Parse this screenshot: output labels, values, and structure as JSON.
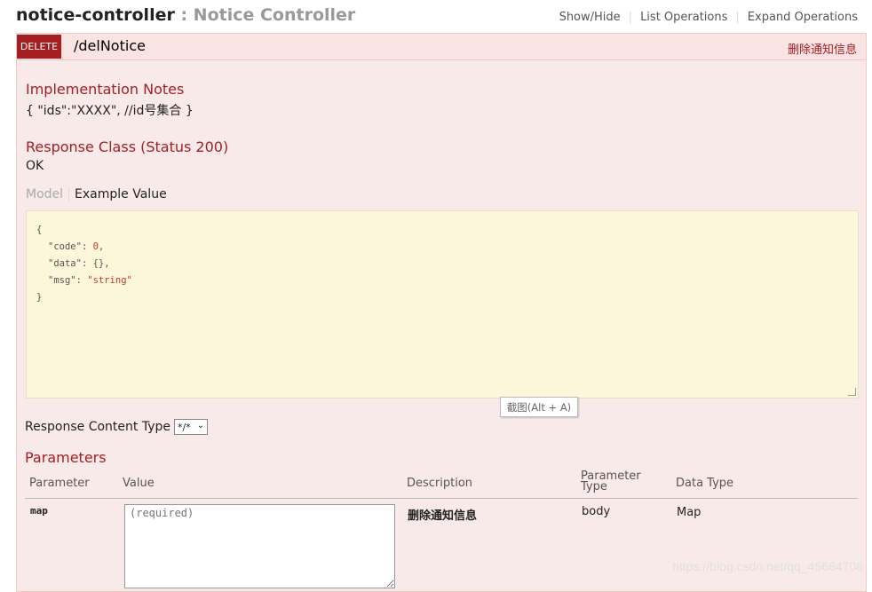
{
  "resource": {
    "name": "notice-controller",
    "separator": " : ",
    "description": "Notice Controller"
  },
  "header_links": {
    "show_hide": "Show/Hide",
    "list_operations": "List Operations",
    "expand_operations": "Expand Operations"
  },
  "operation": {
    "method": "DELETE",
    "path": "/delNotice",
    "summary": "删除通知信息",
    "implementation_notes_title": "Implementation Notes",
    "implementation_notes": "{ \"ids\":\"XXXX\", //id号集合 }",
    "response_class_title": "Response Class (Status 200)",
    "response_class_value": "OK",
    "tabs": {
      "model": "Model",
      "example": "Example Value"
    },
    "example": {
      "open": "{",
      "line1_key": "\"code\"",
      "line1_val": "0",
      "line2_key": "\"data\"",
      "line2_val": "{}",
      "line3_key": "\"msg\"",
      "line3_val": "\"string\"",
      "close": "}"
    },
    "tooltip": "截图(Alt + A)",
    "response_content_type_label": "Response Content Type",
    "response_content_type_value": "*/*",
    "parameters_title": "Parameters",
    "parameters_table": {
      "headers": [
        "Parameter",
        "Value",
        "Description",
        "Parameter\nType",
        "Data Type"
      ],
      "rows": [
        {
          "parameter": "map",
          "value_placeholder": "(required)",
          "description": "删除通知信息",
          "param_type": "body",
          "data_type": "Map"
        }
      ]
    }
  },
  "watermark": "https://blog.csdn.net/qq_45684708",
  "colors": {
    "delete_badge": "#a41e22",
    "op_background": "#f9eaea",
    "snippet_background": "#fcf6db"
  }
}
